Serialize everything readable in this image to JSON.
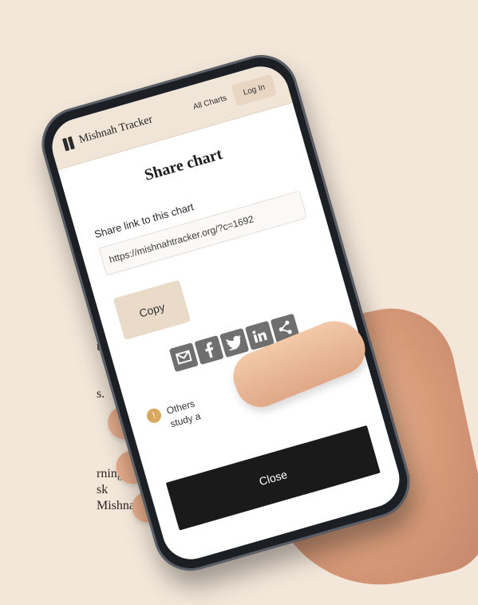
{
  "page": {
    "background_color": "#f3e7da",
    "left_text_fragments": [
      "ed",
      "ur",
      "s.",
      "rning",
      "sk",
      "Mishnah to"
    ]
  },
  "app": {
    "brand": "Mishnah Tracker",
    "nav": {
      "all_charts": "All Charts",
      "login": "Log In"
    }
  },
  "modal": {
    "title": "Share chart",
    "link_label": "Share link to this chart",
    "link_value": "https://mishnahtracker.org/?c=1692",
    "copy_label": "Copy",
    "share_icons": [
      "email-icon",
      "facebook-icon",
      "twitter-icon",
      "linkedin-icon",
      "share-icon"
    ],
    "notice_icon": "info-icon",
    "notice_lines": [
      "Others",
      "study a"
    ],
    "close_label": "Close"
  },
  "colors": {
    "header_bg": "#f1e5d8",
    "copy_bg": "#eadbc9",
    "share_icon_bg": "#6f6f6f",
    "close_bg": "#1a1a1a",
    "info_icon": "#d9a85c"
  }
}
